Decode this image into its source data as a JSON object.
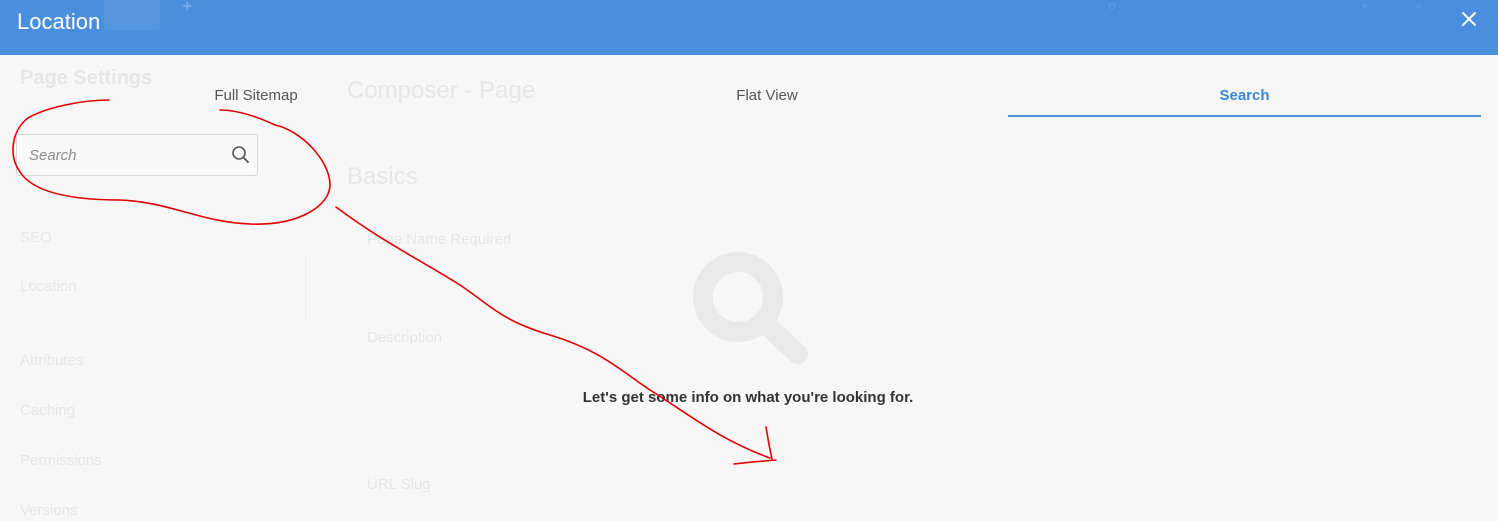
{
  "background_page": {
    "sidebar_title": "Page Settings",
    "main_title": "Composer - Page",
    "section_title": "Basics",
    "sidebar_items": [
      "SEO",
      "Location",
      "Attributes",
      "Caching",
      "Permissions",
      "Versions"
    ],
    "field_labels": [
      "Page Name Required",
      "Description",
      "URL Slug"
    ]
  },
  "dialog": {
    "title": "Location",
    "close_icon": "close-icon"
  },
  "tabs": [
    {
      "label": "Full Sitemap",
      "active": false
    },
    {
      "label": "Flat View",
      "active": false
    },
    {
      "label": "Search",
      "active": true
    }
  ],
  "search": {
    "placeholder": "Search",
    "value": "",
    "icon": "search-icon"
  },
  "empty_state": {
    "icon": "magnifier-icon",
    "message": "Let's get some info on what you're looking for."
  },
  "colors": {
    "header": "#4a8fdd",
    "accent": "#3a87d6",
    "annotation": "#e00000"
  }
}
